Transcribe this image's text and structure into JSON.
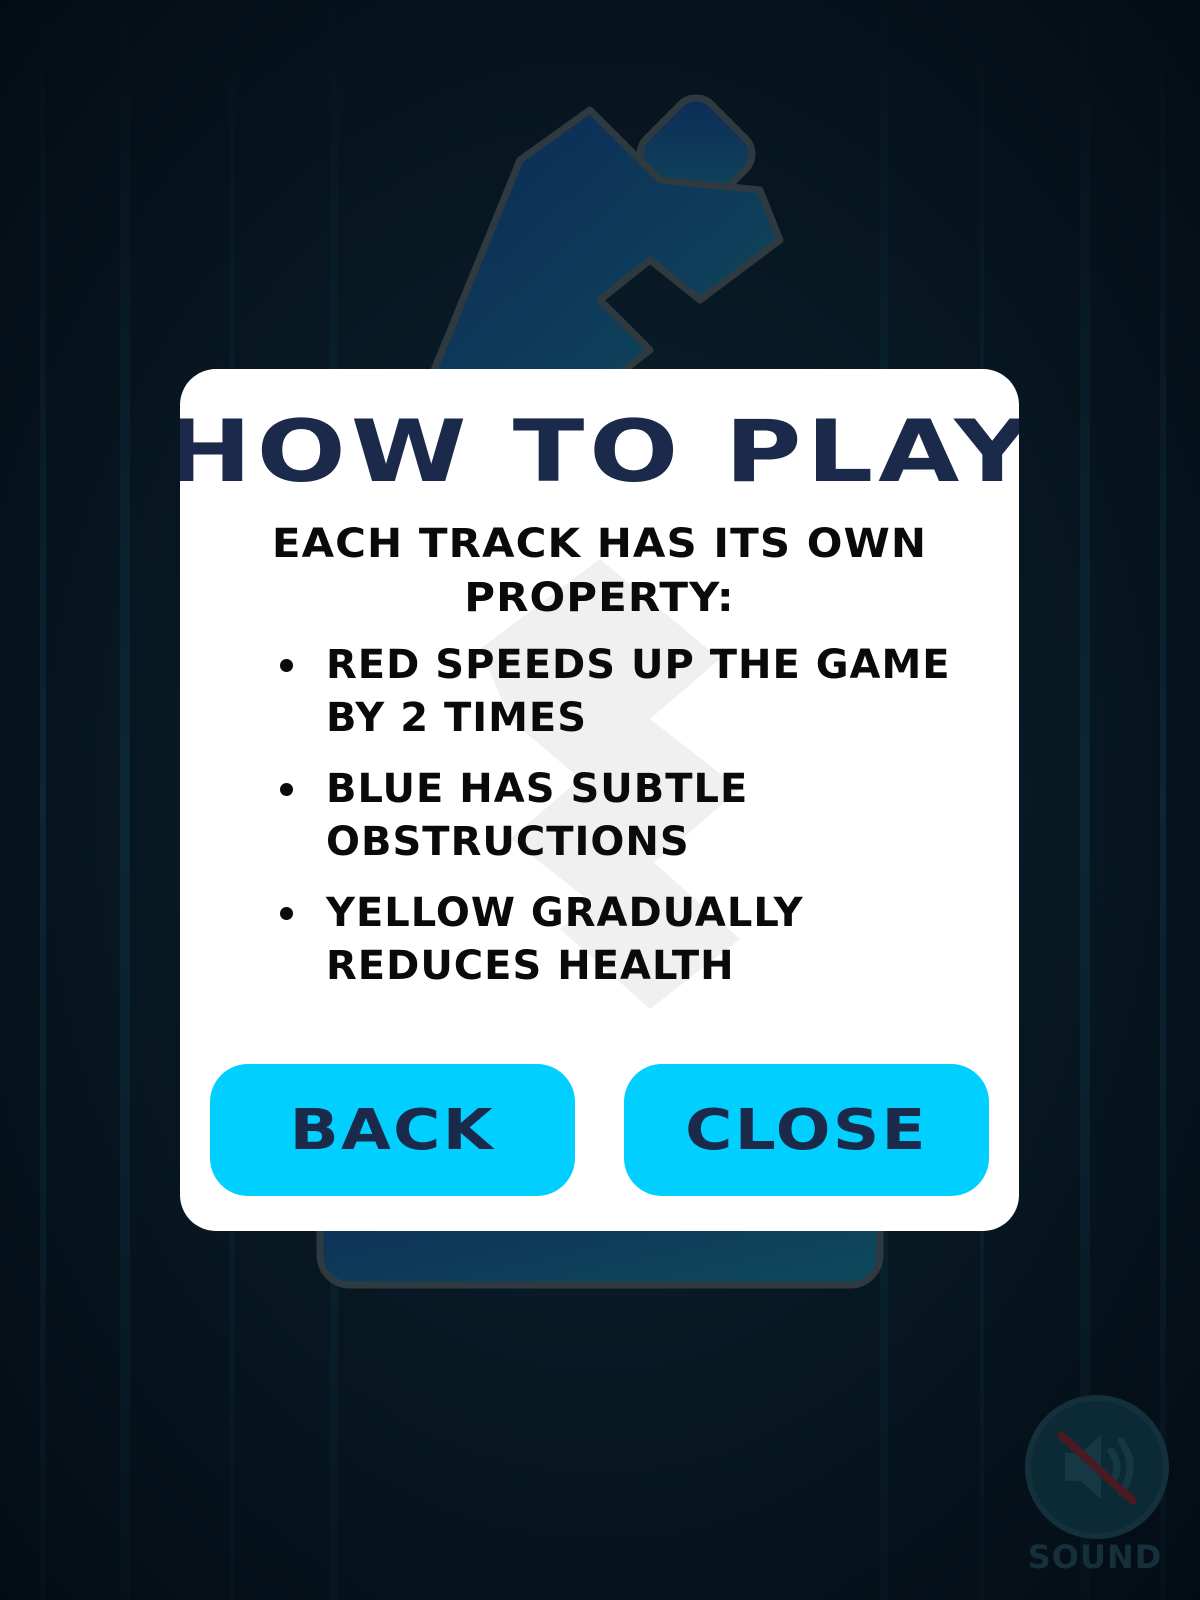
{
  "modal": {
    "title": "HOW TO PLAY",
    "intro": "EACH TRACK HAS ITS OWN PROPERTY:",
    "rules": [
      "RED SPEEDS UP THE GAME BY 2 TIMES",
      "BLUE HAS SUBTLE OBSTRUCTIONS",
      "YELLOW GRADUALLY REDUCES HEALTH"
    ],
    "buttons": {
      "back_label": "BACK",
      "close_label": "CLOSE"
    }
  },
  "sound": {
    "label": "SOUND",
    "state": "muted",
    "icon": "speaker-muted-icon"
  },
  "colors": {
    "background": "#071722",
    "modal": "#ffffff",
    "title": "#1b2a4a",
    "button": "#00cfff",
    "button_text": "#1b2a4a"
  }
}
